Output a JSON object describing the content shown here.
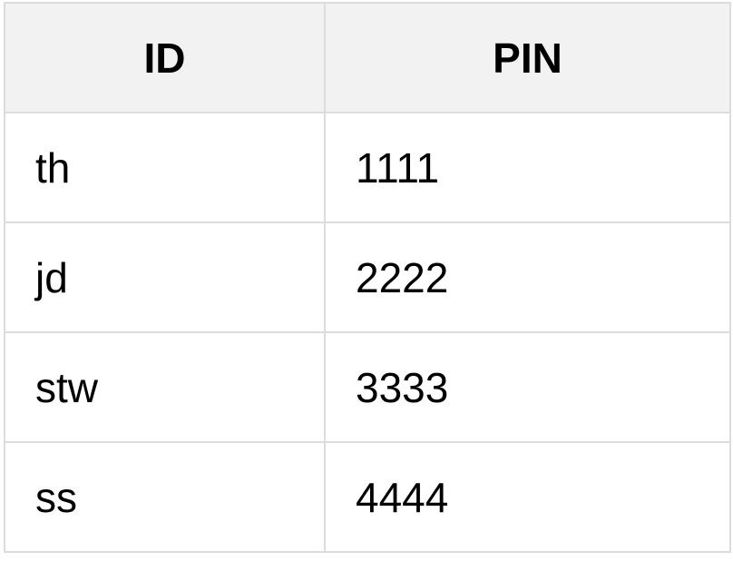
{
  "table": {
    "headers": [
      "ID",
      "PIN"
    ],
    "rows": [
      [
        "th",
        "1111"
      ],
      [
        "jd",
        "2222"
      ],
      [
        "stw",
        "3333"
      ],
      [
        "ss",
        "4444"
      ]
    ]
  }
}
